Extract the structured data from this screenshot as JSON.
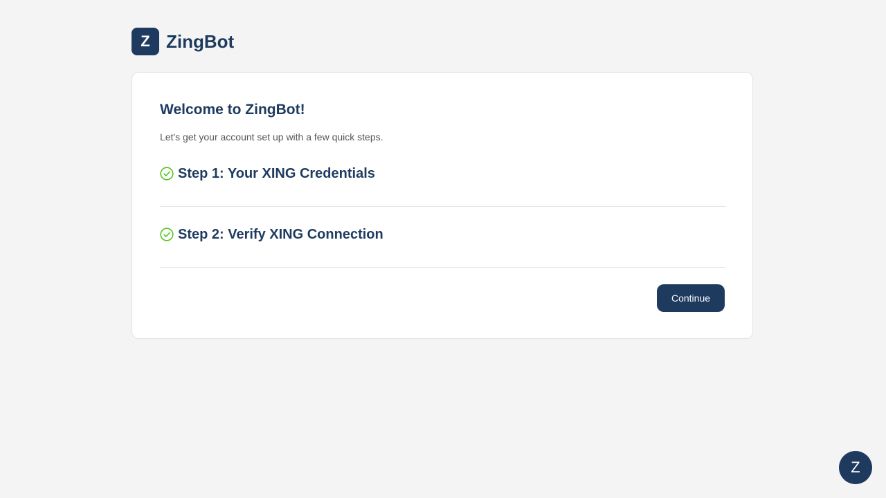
{
  "brand": {
    "logo_letter": "Z",
    "name": "ZingBot"
  },
  "onboarding": {
    "title": "Welcome to ZingBot!",
    "subtitle": "Let's get your account set up with a few quick steps.",
    "steps": [
      {
        "label": "Step 1: Your XING Credentials",
        "status": "completed",
        "icon": "check-circle-icon"
      },
      {
        "label": "Step 2: Verify XING Connection",
        "status": "completed",
        "icon": "check-circle-icon"
      }
    ],
    "continue_label": "Continue"
  },
  "chat_widget": {
    "letter": "Z"
  },
  "colors": {
    "brand_primary": "#1e3a5f",
    "success": "#52c41a",
    "background": "#f4f4f4"
  }
}
